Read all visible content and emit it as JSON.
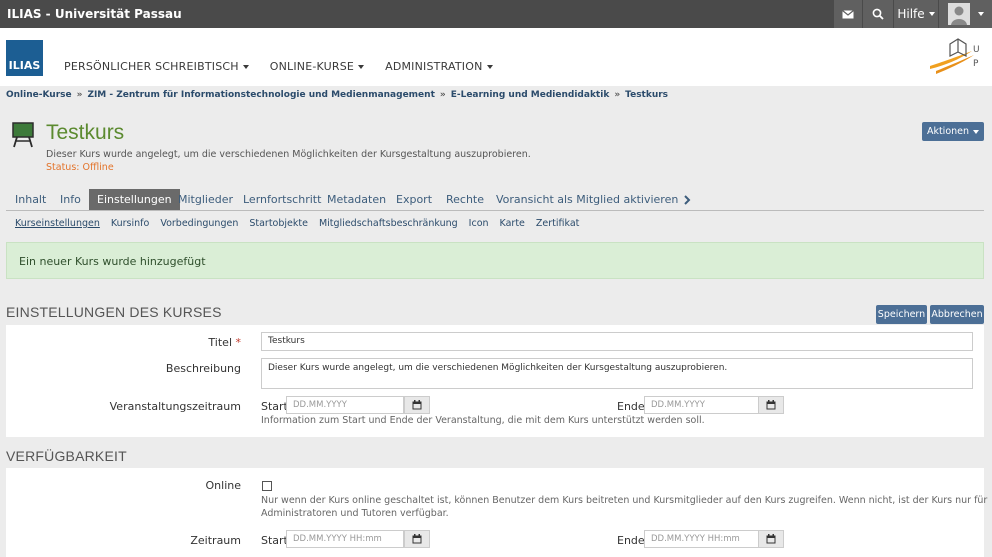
{
  "topbar": {
    "brand": "ILIAS - Universität Passau",
    "help_label": "Hilfe",
    "icons": [
      "mail-icon",
      "search-icon",
      "avatar-icon"
    ]
  },
  "header": {
    "logo_text": "ILIAS",
    "nav": [
      "PERSÖNLICHER SCHREIBTISCH",
      "ONLINE-KURSE",
      "ADMINISTRATION"
    ]
  },
  "breadcrumb": [
    "Online-Kurse",
    "ZIM - Zentrum für Informationstechnologie und Medienmanagement",
    "E-Learning und Mediendidaktik",
    "Testkurs"
  ],
  "breadcrumb_sep": "»",
  "course": {
    "title": "Testkurs",
    "description": "Dieser Kurs wurde angelegt, um die verschiedenen Möglichkeiten der Kursgestaltung auszuprobieren.",
    "status": "Status: Offline",
    "actions_label": "Aktionen"
  },
  "tabs": [
    "Inhalt",
    "Info",
    "Einstellungen",
    "Mitglieder",
    "Lernfortschritt",
    "Metadaten",
    "Export",
    "Rechte",
    "Voransicht als Mitglied aktivieren"
  ],
  "active_tab": "Einstellungen",
  "subtabs": [
    "Kurseinstellungen",
    "Kursinfo",
    "Vorbedingungen",
    "Startobjekte",
    "Mitgliedschaftsbeschränkung",
    "Icon",
    "Karte",
    "Zertifikat"
  ],
  "message": "Ein neuer Kurs wurde hinzugefügt",
  "settings": {
    "title": "EINSTELLUNGEN DES KURSES",
    "save": "Speichern",
    "cancel": "Abbrechen",
    "title_label": "Titel",
    "title_required": "*",
    "title_value": "Testkurs",
    "desc_label": "Beschreibung",
    "desc_value": "Dieser Kurs wurde angelegt, um die verschiedenen Möglichkeiten der Kursgestaltung auszuprobieren.",
    "period_label": "Veranstaltungszeitraum",
    "start_label": "Start",
    "end_label": "Ende",
    "date_placeholder": "DD.MM.YYYY",
    "period_info": "Information zum Start und Ende der Veranstaltung, die mit dem Kurs unterstützt werden soll."
  },
  "availability": {
    "title": "VERFÜGBARKEIT",
    "online_label": "Online",
    "online_info_1": "Nur wenn der Kurs online geschaltet ist, können Benutzer dem Kurs beitreten und Kursmitglieder auf den Kurs zugreifen. Wenn nicht, ist der Kurs nur für",
    "online_info_2": "Administratoren und Tutoren verfügbar.",
    "period_label": "Zeitraum",
    "start_label": "Start",
    "end_label": "Ende",
    "datetime_placeholder": "DD.MM.YYYY HH:mm"
  },
  "colors": {
    "topbar": "#4a4a4a",
    "title_green": "#5b8a2f",
    "status_orange": "#e3742b",
    "button_blue": "#4c6f96",
    "success_bg": "#daeed6"
  }
}
